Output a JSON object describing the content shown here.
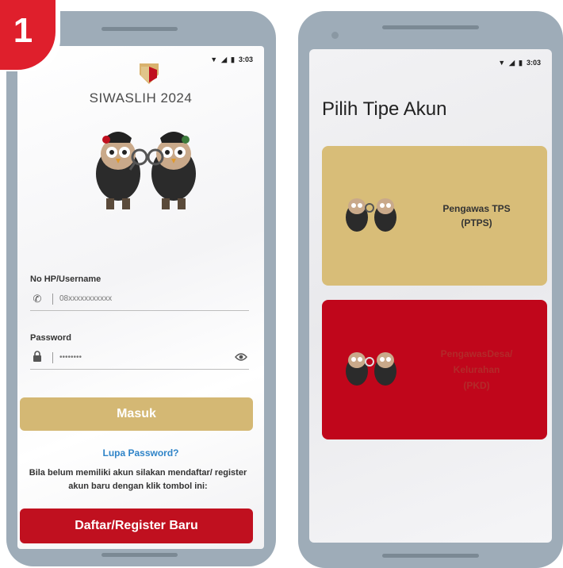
{
  "step_badge": "1",
  "status_bar": {
    "time": "3:03",
    "wifi_icon": "wifi-icon",
    "signal_icon": "signal-icon",
    "battery_icon": "battery-icon"
  },
  "login": {
    "app_title": "SIWASLIH 2024",
    "username_label": "No HP/Username",
    "username_placeholder": "08xxxxxxxxxxx",
    "password_label": "Password",
    "password_value": "********",
    "login_button": "Masuk",
    "forgot_link": "Lupa Password?",
    "register_note": "Bila belum memiliki akun silakan mendaftar/ register akun baru dengan klik tombol ini:",
    "register_button": "Daftar/Register Baru"
  },
  "account_type": {
    "title": "Pilih Tipe Akun",
    "options": [
      {
        "line1": "Pengawas TPS",
        "line2": "(PTPS)",
        "line3": ""
      },
      {
        "line1": "PengawasDesa/",
        "line2": "Kelurahan",
        "line3": "(PKD)"
      }
    ]
  },
  "colors": {
    "gold": "#d4b874",
    "red": "#c0101f",
    "badge_red": "#df1f2c",
    "link_blue": "#2f84c8",
    "phone_frame": "#9eacb8"
  }
}
